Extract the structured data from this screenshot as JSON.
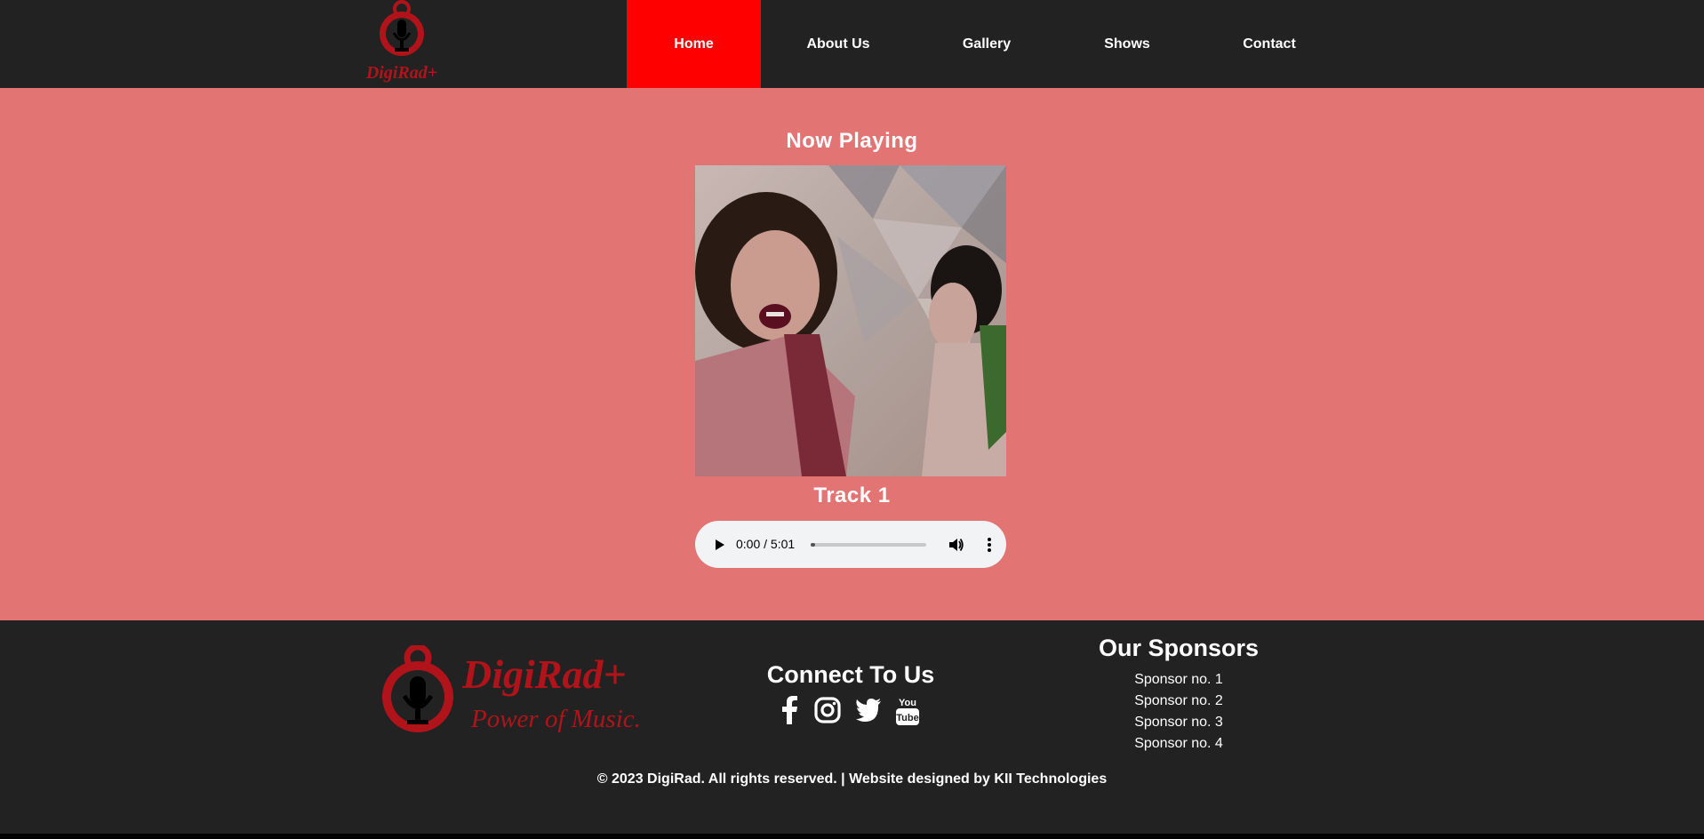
{
  "nav": {
    "logo_text": "DigiRad+",
    "items": [
      {
        "label": "Home",
        "active": true
      },
      {
        "label": "About Us",
        "active": false
      },
      {
        "label": "Gallery",
        "active": false
      },
      {
        "label": "Shows",
        "active": false
      },
      {
        "label": "Contact",
        "active": false
      }
    ]
  },
  "main": {
    "heading": "Now Playing",
    "track_title": "Track 1",
    "player": {
      "time": "0:00 / 5:01",
      "progress": 0.02
    }
  },
  "footer": {
    "logo_title": "DigiRad+",
    "logo_tagline": "Power of Music.",
    "connect_title": "Connect To Us",
    "social_icons": [
      "facebook-icon",
      "instagram-icon",
      "twitter-icon",
      "youtube-icon"
    ],
    "youtube_text_top": "You",
    "youtube_text_bottom": "Tube",
    "sponsors_title": "Our Sponsors",
    "sponsors": [
      "Sponsor no. 1",
      "Sponsor no. 2",
      "Sponsor no. 3",
      "Sponsor no. 4"
    ],
    "copyright": "© 2023 DigiRad. All rights reserved. | Website designed by KII Technologies"
  },
  "colors": {
    "nav_bg": "#222222",
    "active_nav": "#ff0000",
    "main_bg": "#e27474",
    "brand_red": "#b0141a"
  }
}
